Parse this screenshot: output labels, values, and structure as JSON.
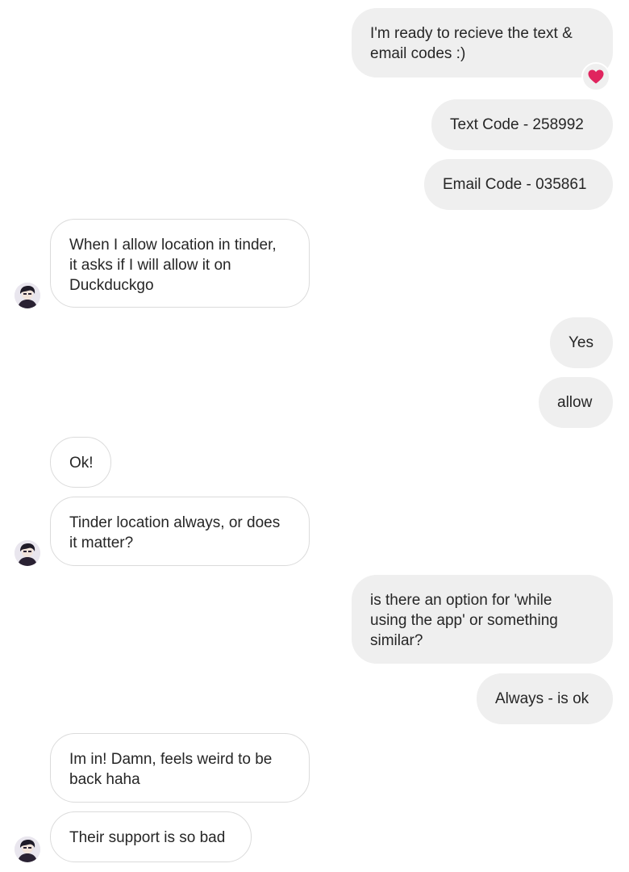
{
  "messages": [
    {
      "text": "I'm ready to recieve the text &\nemail codes :)"
    },
    {
      "text": "Text Code - 258992"
    },
    {
      "text": "Email Code - 035861"
    },
    {
      "text": "When I allow location in tinder,\nit asks if I will allow it on\nDuckduckgo"
    },
    {
      "text": "Yes"
    },
    {
      "text": "allow"
    },
    {
      "text": "Ok!"
    },
    {
      "text": "Tinder location always, or does\nit matter?"
    },
    {
      "text": "is there an option for 'while\nusing the app' or something\nsimilar?"
    },
    {
      "text": "Always - is ok"
    },
    {
      "text": "Im in! Damn, feels weird to be\nback haha"
    },
    {
      "text": "Their support is so bad"
    }
  ],
  "reaction": {
    "icon": "heart-icon",
    "color": "#e0245e"
  },
  "avatar": {
    "icon": "user-avatar-icon"
  },
  "colors": {
    "sent_bubble": "#efefef",
    "received_border": "#dbdbdb",
    "text": "#262626"
  }
}
